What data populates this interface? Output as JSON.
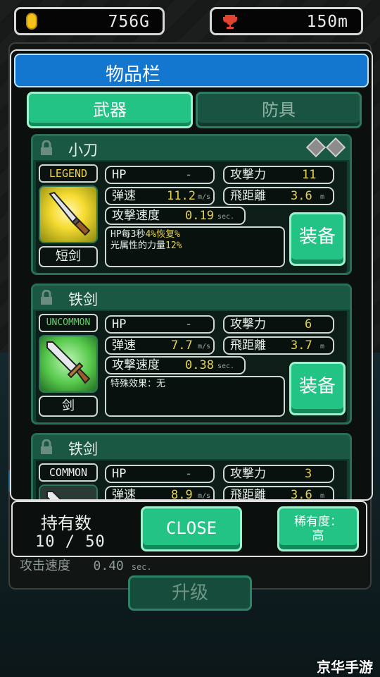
{
  "hud": {
    "gold": "756G",
    "distance": "150m"
  },
  "background": {
    "ghost_stat_label": "攻击速度",
    "ghost_stat_value": "0.40",
    "ghost_stat_unit": "sec.",
    "upgrade_label": "升级"
  },
  "modal": {
    "title": "物品栏",
    "tabs": [
      {
        "label": "武器",
        "active": true
      },
      {
        "label": "防具",
        "active": false
      }
    ],
    "items": [
      {
        "name": "小刀",
        "rarity": "LEGEND",
        "type": "短剑",
        "gems": 2,
        "hp_label": "HP",
        "hp_value": "-",
        "atk_label": "攻撃力",
        "atk_value": "11",
        "speed_label": "弹速",
        "speed_value": "11.2",
        "speed_unit": "m/s",
        "range_label": "飛距離",
        "range_value": "3.6",
        "range_unit": "m",
        "atkspd_label": "攻撃速度",
        "atkspd_value": "0.19",
        "atkspd_unit": "sec.",
        "desc_1a": "HP每3秒",
        "desc_1b": "4%恢复%",
        "desc_2a": "光属性的力量",
        "desc_2b": "12%",
        "equip_label": "装备"
      },
      {
        "name": "铁剑",
        "rarity": "UNCOMMON",
        "type": "剑",
        "hp_label": "HP",
        "hp_value": "-",
        "atk_label": "攻撃力",
        "atk_value": "6",
        "speed_label": "弹速",
        "speed_value": "7.7",
        "speed_unit": "m/s",
        "range_label": "飛距離",
        "range_value": "3.7",
        "range_unit": "m",
        "atkspd_label": "攻撃速度",
        "atkspd_value": "0.38",
        "atkspd_unit": "sec.",
        "desc_1a": "特殊效果：无",
        "desc_1b": "",
        "equip_label": "装备"
      },
      {
        "name": "铁剑",
        "rarity": "COMMON",
        "hp_label": "HP",
        "hp_value": "-",
        "atk_label": "攻撃力",
        "atk_value": "3",
        "speed_label": "弹速",
        "speed_value": "8.9",
        "speed_unit": "m/s",
        "range_label": "飛距離",
        "range_value": "3.6",
        "range_unit": "m"
      }
    ]
  },
  "footer": {
    "own_label": "持有数",
    "own_count": "10 / 50",
    "close_label": "CLOSE",
    "rarity_line1": "稀有度：",
    "rarity_line2": "高"
  },
  "watermark": "京华手游",
  "colors": {
    "accent": "#22c384",
    "title_bar": "#1377cf",
    "legend": "#f0d24a",
    "uncommon": "#62d86a",
    "value": "#e6d24a"
  }
}
